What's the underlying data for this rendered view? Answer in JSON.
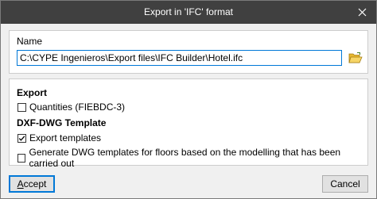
{
  "window": {
    "title": "Export in 'IFC' format"
  },
  "name_group": {
    "label": "Name",
    "path_value": "C:\\CYPE Ingenieros\\Export files\\IFC Builder\\Hotel.ifc"
  },
  "export_group": {
    "export_heading": "Export",
    "quantities_label": "Quantities (FIEBDC-3)",
    "quantities_checked": false,
    "dxf_heading": "DXF-DWG Template",
    "export_templates_label": "Export templates",
    "export_templates_checked": true,
    "generate_dwg_label": "Generate DWG templates for floors based on the modelling that has been carried out",
    "generate_dwg_checked": false
  },
  "buttons": {
    "accept_underlined": "A",
    "accept_rest": "ccept",
    "cancel_label": "Cancel"
  },
  "icons": {
    "folder": "folder-open-icon",
    "close": "close-icon"
  },
  "colors": {
    "titlebar": "#404040",
    "accent": "#0078d7",
    "folder": "#f2c94c"
  }
}
